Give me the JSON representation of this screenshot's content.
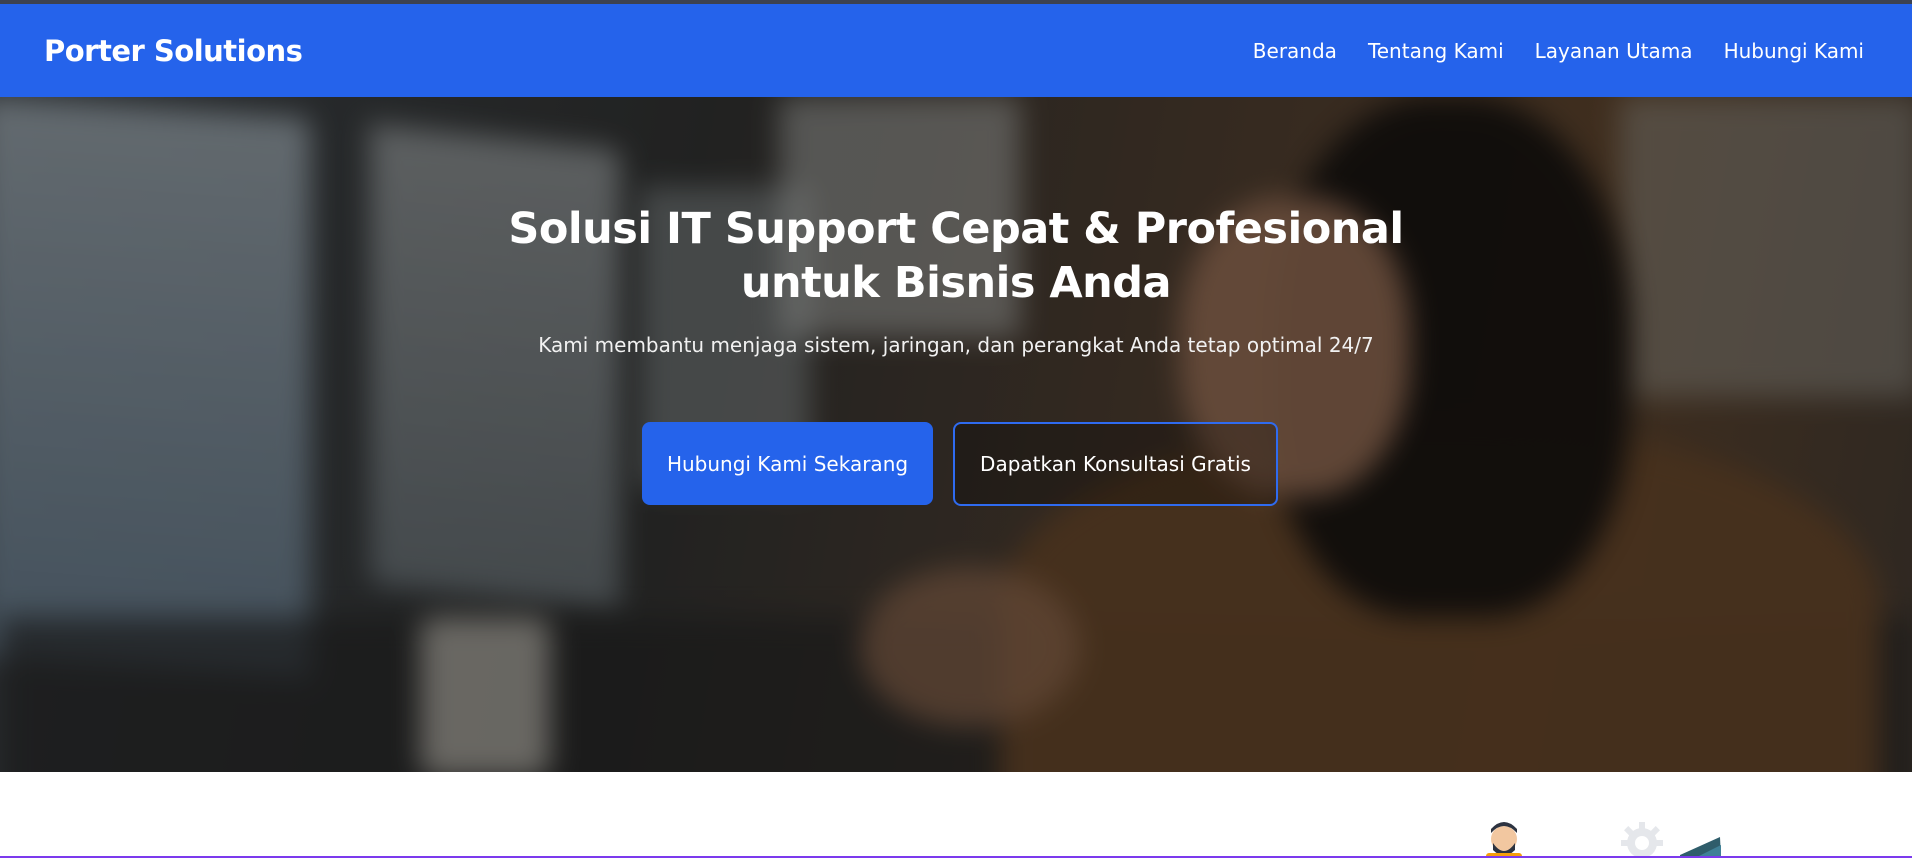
{
  "brand": {
    "name": "Porter Solutions"
  },
  "nav": {
    "items": [
      {
        "label": "Beranda"
      },
      {
        "label": "Tentang Kami"
      },
      {
        "label": "Layanan Utama"
      },
      {
        "label": "Hubungi Kami"
      }
    ]
  },
  "hero": {
    "title_line1": "Solusi IT Support Cepat & Profesional",
    "title_line2": "untuk Bisnis Anda",
    "subtitle": "Kami membantu menjaga sistem, jaringan, dan perangkat Anda tetap optimal 24/7",
    "primary_button": "Hubungi Kami Sekarang",
    "secondary_button": "Dapatkan Konsultasi Gratis"
  },
  "colors": {
    "primary": "#2563eb",
    "text_light": "#ffffff",
    "accent_line": "#7c3aed"
  },
  "icons": {
    "lower_illustration": [
      "support-person-icon",
      "gear-icon",
      "chart-icon"
    ]
  }
}
